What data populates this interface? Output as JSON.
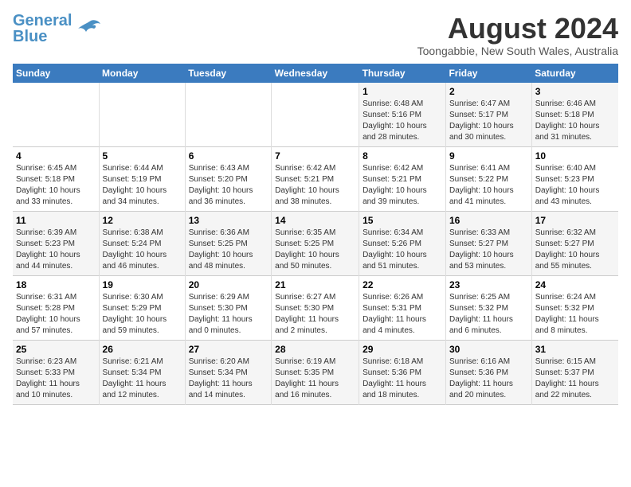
{
  "header": {
    "logo_general": "General",
    "logo_blue": "Blue",
    "month_year": "August 2024",
    "location": "Toongabbie, New South Wales, Australia"
  },
  "weekdays": [
    "Sunday",
    "Monday",
    "Tuesday",
    "Wednesday",
    "Thursday",
    "Friday",
    "Saturday"
  ],
  "weeks": [
    [
      {
        "day": "",
        "info": ""
      },
      {
        "day": "",
        "info": ""
      },
      {
        "day": "",
        "info": ""
      },
      {
        "day": "",
        "info": ""
      },
      {
        "day": "1",
        "info": "Sunrise: 6:48 AM\nSunset: 5:16 PM\nDaylight: 10 hours\nand 28 minutes."
      },
      {
        "day": "2",
        "info": "Sunrise: 6:47 AM\nSunset: 5:17 PM\nDaylight: 10 hours\nand 30 minutes."
      },
      {
        "day": "3",
        "info": "Sunrise: 6:46 AM\nSunset: 5:18 PM\nDaylight: 10 hours\nand 31 minutes."
      }
    ],
    [
      {
        "day": "4",
        "info": "Sunrise: 6:45 AM\nSunset: 5:18 PM\nDaylight: 10 hours\nand 33 minutes."
      },
      {
        "day": "5",
        "info": "Sunrise: 6:44 AM\nSunset: 5:19 PM\nDaylight: 10 hours\nand 34 minutes."
      },
      {
        "day": "6",
        "info": "Sunrise: 6:43 AM\nSunset: 5:20 PM\nDaylight: 10 hours\nand 36 minutes."
      },
      {
        "day": "7",
        "info": "Sunrise: 6:42 AM\nSunset: 5:21 PM\nDaylight: 10 hours\nand 38 minutes."
      },
      {
        "day": "8",
        "info": "Sunrise: 6:42 AM\nSunset: 5:21 PM\nDaylight: 10 hours\nand 39 minutes."
      },
      {
        "day": "9",
        "info": "Sunrise: 6:41 AM\nSunset: 5:22 PM\nDaylight: 10 hours\nand 41 minutes."
      },
      {
        "day": "10",
        "info": "Sunrise: 6:40 AM\nSunset: 5:23 PM\nDaylight: 10 hours\nand 43 minutes."
      }
    ],
    [
      {
        "day": "11",
        "info": "Sunrise: 6:39 AM\nSunset: 5:23 PM\nDaylight: 10 hours\nand 44 minutes."
      },
      {
        "day": "12",
        "info": "Sunrise: 6:38 AM\nSunset: 5:24 PM\nDaylight: 10 hours\nand 46 minutes."
      },
      {
        "day": "13",
        "info": "Sunrise: 6:36 AM\nSunset: 5:25 PM\nDaylight: 10 hours\nand 48 minutes."
      },
      {
        "day": "14",
        "info": "Sunrise: 6:35 AM\nSunset: 5:25 PM\nDaylight: 10 hours\nand 50 minutes."
      },
      {
        "day": "15",
        "info": "Sunrise: 6:34 AM\nSunset: 5:26 PM\nDaylight: 10 hours\nand 51 minutes."
      },
      {
        "day": "16",
        "info": "Sunrise: 6:33 AM\nSunset: 5:27 PM\nDaylight: 10 hours\nand 53 minutes."
      },
      {
        "day": "17",
        "info": "Sunrise: 6:32 AM\nSunset: 5:27 PM\nDaylight: 10 hours\nand 55 minutes."
      }
    ],
    [
      {
        "day": "18",
        "info": "Sunrise: 6:31 AM\nSunset: 5:28 PM\nDaylight: 10 hours\nand 57 minutes."
      },
      {
        "day": "19",
        "info": "Sunrise: 6:30 AM\nSunset: 5:29 PM\nDaylight: 10 hours\nand 59 minutes."
      },
      {
        "day": "20",
        "info": "Sunrise: 6:29 AM\nSunset: 5:30 PM\nDaylight: 11 hours\nand 0 minutes."
      },
      {
        "day": "21",
        "info": "Sunrise: 6:27 AM\nSunset: 5:30 PM\nDaylight: 11 hours\nand 2 minutes."
      },
      {
        "day": "22",
        "info": "Sunrise: 6:26 AM\nSunset: 5:31 PM\nDaylight: 11 hours\nand 4 minutes."
      },
      {
        "day": "23",
        "info": "Sunrise: 6:25 AM\nSunset: 5:32 PM\nDaylight: 11 hours\nand 6 minutes."
      },
      {
        "day": "24",
        "info": "Sunrise: 6:24 AM\nSunset: 5:32 PM\nDaylight: 11 hours\nand 8 minutes."
      }
    ],
    [
      {
        "day": "25",
        "info": "Sunrise: 6:23 AM\nSunset: 5:33 PM\nDaylight: 11 hours\nand 10 minutes."
      },
      {
        "day": "26",
        "info": "Sunrise: 6:21 AM\nSunset: 5:34 PM\nDaylight: 11 hours\nand 12 minutes."
      },
      {
        "day": "27",
        "info": "Sunrise: 6:20 AM\nSunset: 5:34 PM\nDaylight: 11 hours\nand 14 minutes."
      },
      {
        "day": "28",
        "info": "Sunrise: 6:19 AM\nSunset: 5:35 PM\nDaylight: 11 hours\nand 16 minutes."
      },
      {
        "day": "29",
        "info": "Sunrise: 6:18 AM\nSunset: 5:36 PM\nDaylight: 11 hours\nand 18 minutes."
      },
      {
        "day": "30",
        "info": "Sunrise: 6:16 AM\nSunset: 5:36 PM\nDaylight: 11 hours\nand 20 minutes."
      },
      {
        "day": "31",
        "info": "Sunrise: 6:15 AM\nSunset: 5:37 PM\nDaylight: 11 hours\nand 22 minutes."
      }
    ]
  ]
}
